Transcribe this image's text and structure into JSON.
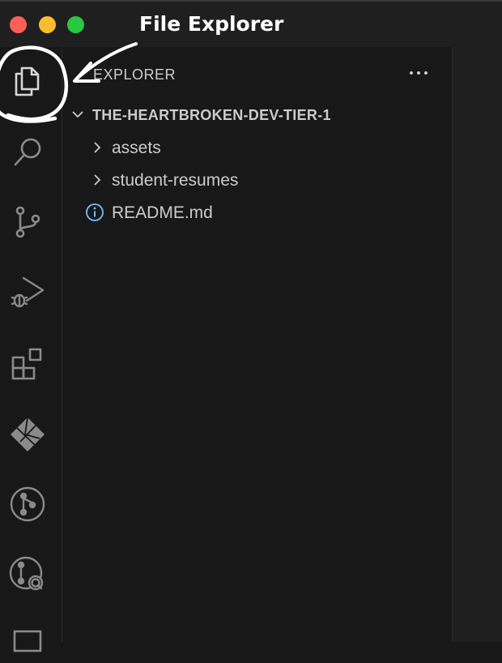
{
  "window": {
    "traffic_lights": [
      {
        "name": "close",
        "color": "#ff5f57"
      },
      {
        "name": "minimize",
        "color": "#febc2e"
      },
      {
        "name": "zoom",
        "color": "#28c840"
      }
    ]
  },
  "annotation": {
    "label": "File Explorer"
  },
  "activity_bar": {
    "items": [
      {
        "icon": "files-icon",
        "active": true
      },
      {
        "icon": "search-icon"
      },
      {
        "icon": "source-control-icon"
      },
      {
        "icon": "run-debug-icon"
      },
      {
        "icon": "extensions-icon"
      },
      {
        "icon": "netlify-icon"
      },
      {
        "icon": "git-graph-icon"
      },
      {
        "icon": "gitlens-inspect-icon"
      },
      {
        "icon": "remote-explorer-icon"
      }
    ]
  },
  "sidebar": {
    "title": "EXPLORER",
    "more_actions_icon": "ellipsis-icon",
    "folder": "THE-HEARTBROKEN-DEV-TIER-1",
    "items": [
      {
        "label": "assets",
        "type": "folder"
      },
      {
        "label": "student-resumes",
        "type": "folder"
      },
      {
        "label": "README.md",
        "type": "file",
        "icon": "info-icon"
      }
    ]
  },
  "colors": {
    "background": "#181818",
    "titlebar": "#1f1f1f",
    "text": "#cccccc",
    "info_icon": "#75beff",
    "annotation": "#ffffff"
  }
}
